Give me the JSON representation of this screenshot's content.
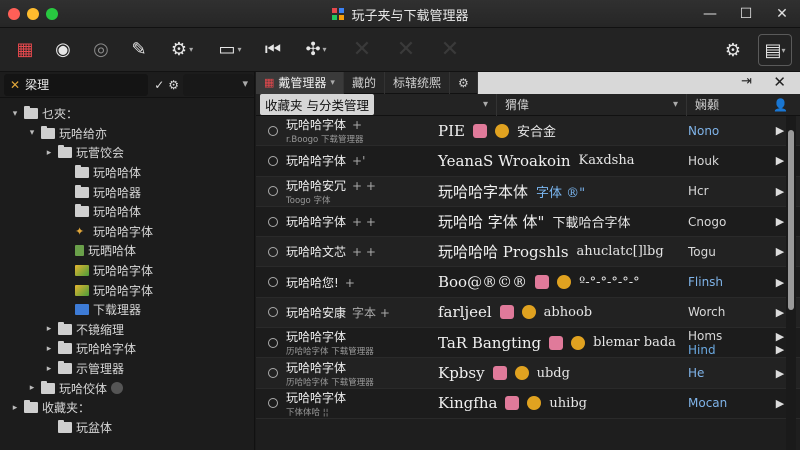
{
  "window": {
    "title": "玩子夹与下载管理器",
    "controls": [
      "—",
      "☐",
      "✕"
    ]
  },
  "toolbar": {
    "buttons": [
      {
        "name": "app-grid-icon",
        "glyph": "▦"
      },
      {
        "name": "camera-icon",
        "glyph": "◉"
      },
      {
        "name": "camera-alt-icon",
        "glyph": "◎"
      },
      {
        "name": "chat-icon",
        "glyph": "✎"
      },
      {
        "name": "gear-icon",
        "glyph": "⚙"
      },
      {
        "name": "monitor-icon",
        "glyph": "▭"
      },
      {
        "name": "rewind-icon",
        "glyph": "⏮"
      },
      {
        "name": "compass-icon",
        "glyph": "✣"
      }
    ],
    "right_buttons": [
      {
        "name": "settings-gear-icon",
        "glyph": "⚙"
      },
      {
        "name": "layout-icon",
        "glyph": "▤"
      }
    ]
  },
  "left_panel": {
    "field_label": "梁理",
    "tree": [
      {
        "label": "乜夾：",
        "level": 1,
        "arrow": "▾",
        "icon": "folder"
      },
      {
        "label": "玩哈给亦",
        "level": 2,
        "arrow": "▾",
        "icon": "folder"
      },
      {
        "label": "玩菅饺会",
        "level": 3,
        "arrow": "▸",
        "icon": "folder"
      },
      {
        "label": "玩哈哈体",
        "level": 4,
        "arrow": "",
        "icon": "folder"
      },
      {
        "label": "玩哈哈器",
        "level": 4,
        "arrow": "",
        "icon": "folder"
      },
      {
        "label": "玩哈哈体",
        "level": 4,
        "arrow": "",
        "icon": "folder"
      },
      {
        "label": "玩哈哈字体",
        "level": 4,
        "arrow": "",
        "icon": "star"
      },
      {
        "label": "玩晒哈体",
        "level": 4,
        "arrow": "",
        "icon": "can"
      },
      {
        "label": "玩哈哈字体",
        "level": 4,
        "arrow": "",
        "icon": "gem"
      },
      {
        "label": "玩哈哈字体",
        "level": 4,
        "arrow": "",
        "icon": "gem"
      },
      {
        "label": "下载理器",
        "level": 4,
        "arrow": "",
        "icon": "blue"
      },
      {
        "label": "不镜缩理",
        "level": 3,
        "arrow": "▸",
        "icon": "folder"
      },
      {
        "label": "玩哈哈字体",
        "level": 3,
        "arrow": "▸",
        "icon": "folder"
      },
      {
        "label": "示管理器",
        "level": 3,
        "arrow": "▸",
        "icon": "folder"
      },
      {
        "label": "玩哈佼体",
        "level": 2,
        "arrow": "▸",
        "icon": "folder",
        "extra": "dot"
      },
      {
        "label": "收藏夹：",
        "level": 1,
        "arrow": "▸",
        "icon": "folder"
      },
      {
        "label": "玩盆体",
        "level": 3,
        "arrow": "",
        "icon": "folder"
      }
    ]
  },
  "right_panel": {
    "tabs": [
      {
        "label": "戴管理器",
        "active": true,
        "caret": "▾"
      },
      {
        "label": "藏的",
        "active": false
      },
      {
        "label": "标辖统熈",
        "active": false
      },
      {
        "label": "⚙",
        "active": false
      }
    ],
    "columns": {
      "first": "收藏夹 与分类管理",
      "second": "猬偉",
      "third": "娴颡"
    },
    "rows": [
      {
        "name": "玩哈哈字体",
        "plus": "+",
        "sub": "r.Boogo 下载管理器",
        "sample_a": "PIE",
        "sample_b": "安合金",
        "tag": "Nono",
        "tag_blue": true,
        "arrow": "▶"
      },
      {
        "name": "玩哈哈字体",
        "plus": "+'",
        "sub": "",
        "sample_a": "YeanaS Wroakoin",
        "sample_b": "Kaxdsha",
        "tag": "Houk",
        "tag_blue": false,
        "arrow": "▶"
      },
      {
        "name": "玩哈哈安冗",
        "plus": "+ +",
        "sub": "Toogo 字体",
        "sample_a": "玩哈哈字本体",
        "sample_b": "字体 ®\"",
        "tag": "Hcr",
        "tag_blue": false,
        "arrow": "▶"
      },
      {
        "name": "玩哈哈字体",
        "plus": "+ +",
        "sub": "",
        "sample_a": "玩哈哈 字体 体\"",
        "sample_b": "下載哈合字体",
        "tag": "Cnogo",
        "tag_blue": false,
        "arrow": "▶"
      },
      {
        "name": "玩哈哈文芯",
        "plus": "+ +",
        "sub": "",
        "sample_a": "玩哈哈哈 Progshls",
        "sample_b": "ahuclatc[]lbg",
        "tag": "Togu",
        "tag_blue": false,
        "arrow": "▶"
      },
      {
        "name": "玩哈哈您!",
        "plus": "+",
        "sub": "",
        "sample_a": "Boo@®©®",
        "sample_b": "º-°-°-°-°-°",
        "tag": "Flinsh",
        "tag_blue": true,
        "arrow": "▶"
      },
      {
        "name": "玩哈哈安康",
        "plus": "字本 +",
        "sub": "",
        "sample_a": "farljeel",
        "sample_b": "abhoob",
        "tag": "Worch",
        "tag_blue": false,
        "arrow": "▶"
      },
      {
        "name": "玩哈哈字体",
        "plus": "",
        "sub": "历哈哈字体 下载管理器",
        "sample_a": "TaR Bangting",
        "sample_b": "blemar bada",
        "tag": "Homs",
        "tag2": "Hind",
        "tag_blue": false,
        "arrow": "▶"
      },
      {
        "name": "玩哈哈字体",
        "plus": "",
        "sub": "历哈哈字体 下载管理器",
        "sample_a": "Kpbsy",
        "sample_b": "ubdg",
        "tag": "He",
        "tag_blue": true,
        "arrow": "▶"
      },
      {
        "name": "玩哈哈字体",
        "plus": "",
        "sub": "下体体哈 ¦¦",
        "sample_a": "Kingfha",
        "sample_b": "uhibg",
        "tag": "Mocan",
        "tag_blue": true,
        "arrow": "▶"
      }
    ]
  }
}
